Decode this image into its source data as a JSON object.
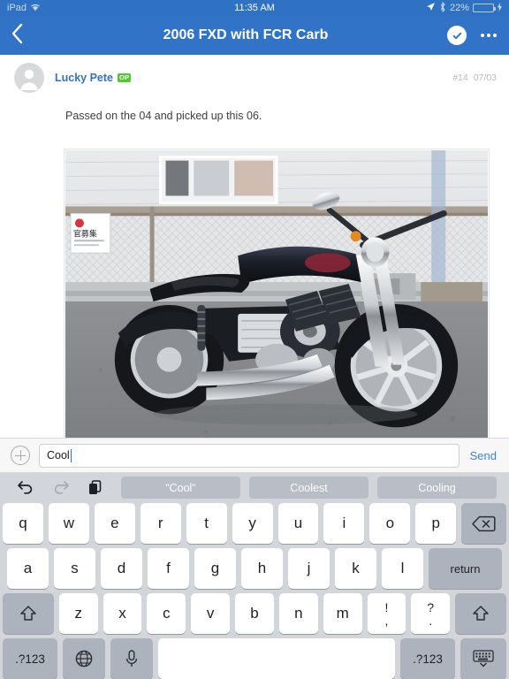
{
  "statusbar": {
    "device": "iPad",
    "wifi_icon": "wifi-icon",
    "time": "11:35 AM",
    "location_icon": "location-arrow-icon",
    "bluetooth_icon": "bluetooth-icon",
    "battery_percent": "22%",
    "battery_level": 22,
    "charging": true
  },
  "navbar": {
    "back_icon": "chevron-left-icon",
    "title": "2006 FXD with FCR Carb",
    "check_icon": "check-circle-icon",
    "more_icon": "more-dots-icon"
  },
  "post": {
    "avatar_icon": "person-avatar-icon",
    "author": "Lucky Pete",
    "badge": "OP",
    "number": "#14",
    "date": "07/03",
    "body": "Passed on the 04 and picked up this 06.",
    "attachment_alt": "black Harley-Davidson Dyna motorcycle parked on asphalt in front of a corrugated wall"
  },
  "inputbar": {
    "add_icon": "plus-circle-icon",
    "value": "Cool",
    "placeholder": "",
    "send_label": "Send"
  },
  "keyboard": {
    "undo_icon": "undo-icon",
    "redo_icon": "redo-icon",
    "paste_icon": "paste-icon",
    "suggestions": [
      "“Cool”",
      "Coolest",
      "Cooling"
    ],
    "row1": [
      "q",
      "w",
      "e",
      "r",
      "t",
      "y",
      "u",
      "i",
      "o",
      "p"
    ],
    "backspace_icon": "backspace-icon",
    "row2": [
      "a",
      "s",
      "d",
      "f",
      "g",
      "h",
      "j",
      "k",
      "l"
    ],
    "return_label": "return",
    "row3": [
      "z",
      "x",
      "c",
      "v",
      "b",
      "n",
      "m"
    ],
    "punc1_top": "!",
    "punc1_bottom": ",",
    "punc2_top": "?",
    "punc2_bottom": ".",
    "shift_icon": "shift-icon",
    "numeric_label": ".?123",
    "globe_icon": "globe-icon",
    "mic_icon": "microphone-icon",
    "space_label": "",
    "hide_keyboard_icon": "hide-keyboard-icon"
  },
  "colors": {
    "nav_blue": "#3173c7",
    "status_blue": "#2f72c4",
    "link_blue": "#3173c7",
    "send_blue": "#3b82e8",
    "op_green": "#4ec930",
    "battery_green": "#4cd964",
    "keyboard_bg": "#d2d5da",
    "key_white": "#ffffff",
    "key_dark": "#adb3bd",
    "chip_gray": "#b9bec6"
  }
}
